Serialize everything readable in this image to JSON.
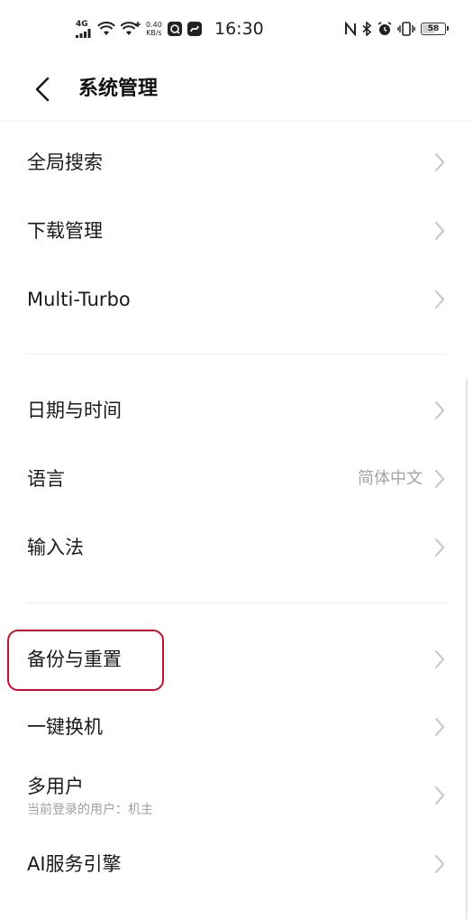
{
  "status_bar": {
    "network": "4G",
    "speed_value": "0.40",
    "speed_unit": "KB/s",
    "time": "16:30",
    "battery": "58",
    "battery_level_percent": 58,
    "icons_left": [
      "signal-icon",
      "wifi-icon",
      "wifi-plus-icon",
      "speed-icon",
      "app-notification-icon",
      "app-notification-icon-2"
    ],
    "icons_right": [
      "nfc-icon",
      "bluetooth-icon",
      "alarm-icon",
      "vibrate-icon",
      "battery-icon"
    ]
  },
  "header": {
    "title": "系统管理"
  },
  "sections": [
    {
      "items": [
        {
          "label": "全局搜索"
        },
        {
          "label": "下载管理"
        },
        {
          "label": "Multi-Turbo"
        }
      ]
    },
    {
      "items": [
        {
          "label": "日期与时间"
        },
        {
          "label": "语言",
          "value": "简体中文"
        },
        {
          "label": "输入法"
        }
      ]
    },
    {
      "items": [
        {
          "label": "备份与重置",
          "highlighted": true
        },
        {
          "label": "一键换机"
        },
        {
          "label": "多用户",
          "sublabel": "当前登录的用户：机主"
        },
        {
          "label": "AI服务引擎"
        }
      ]
    }
  ],
  "colors": {
    "highlight": "#c8102e",
    "secondary_text": "#a3a3a3",
    "chevron": "#c4c4c4"
  }
}
